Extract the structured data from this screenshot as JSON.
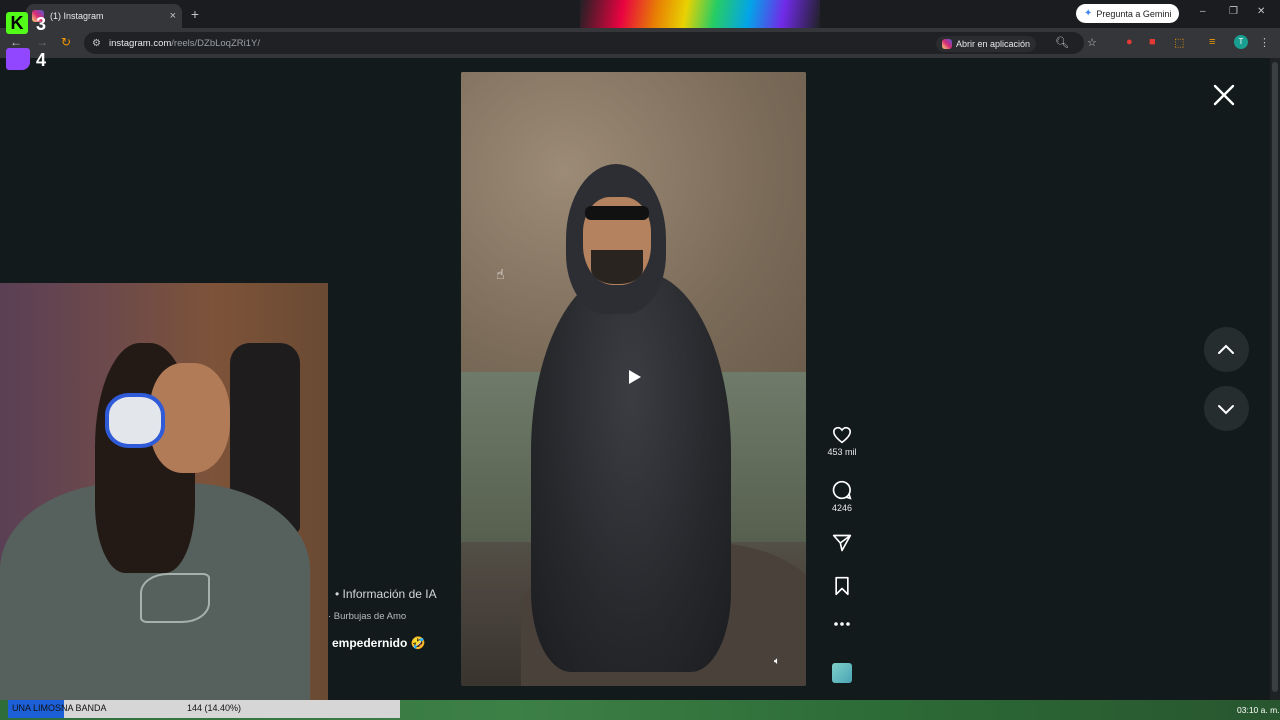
{
  "browser": {
    "tab_title": "(1) Instagram",
    "tab_close": "×",
    "new_tab": "+",
    "gemini_label": "Pregunta a Gemini",
    "url_domain": "instagram.com",
    "url_path": "/reels/DZbLoqZRi1Y/",
    "open_in_app_label": "Abrir en aplicación",
    "profile_initial": "T"
  },
  "reel": {
    "likes": "453 mil",
    "comments": "4246",
    "ai_info": "• Información de IA",
    "audio_name": "· Burbujas de Amo",
    "username": "empedernido 🤣"
  },
  "stream": {
    "kick_count": "3",
    "twitch_count": "4",
    "sub_goal_label": "UNA LIMOSNA BANDA",
    "sub_goal_count": "144 (14.40%)",
    "sub_goal_progress": 0.144,
    "clock": "03:10 a. m."
  },
  "colors": {
    "instagram_bg": "#121a1b",
    "kick_green": "#53fc18",
    "twitch_purple": "#9146ff",
    "goal_blue": "#1c5fd6"
  },
  "icons": [
    "heart-icon",
    "comment-icon",
    "share-icon",
    "bookmark-icon",
    "more-icon",
    "close-icon",
    "chevron-up-icon",
    "chevron-down-icon",
    "play-icon",
    "volume-icon"
  ]
}
